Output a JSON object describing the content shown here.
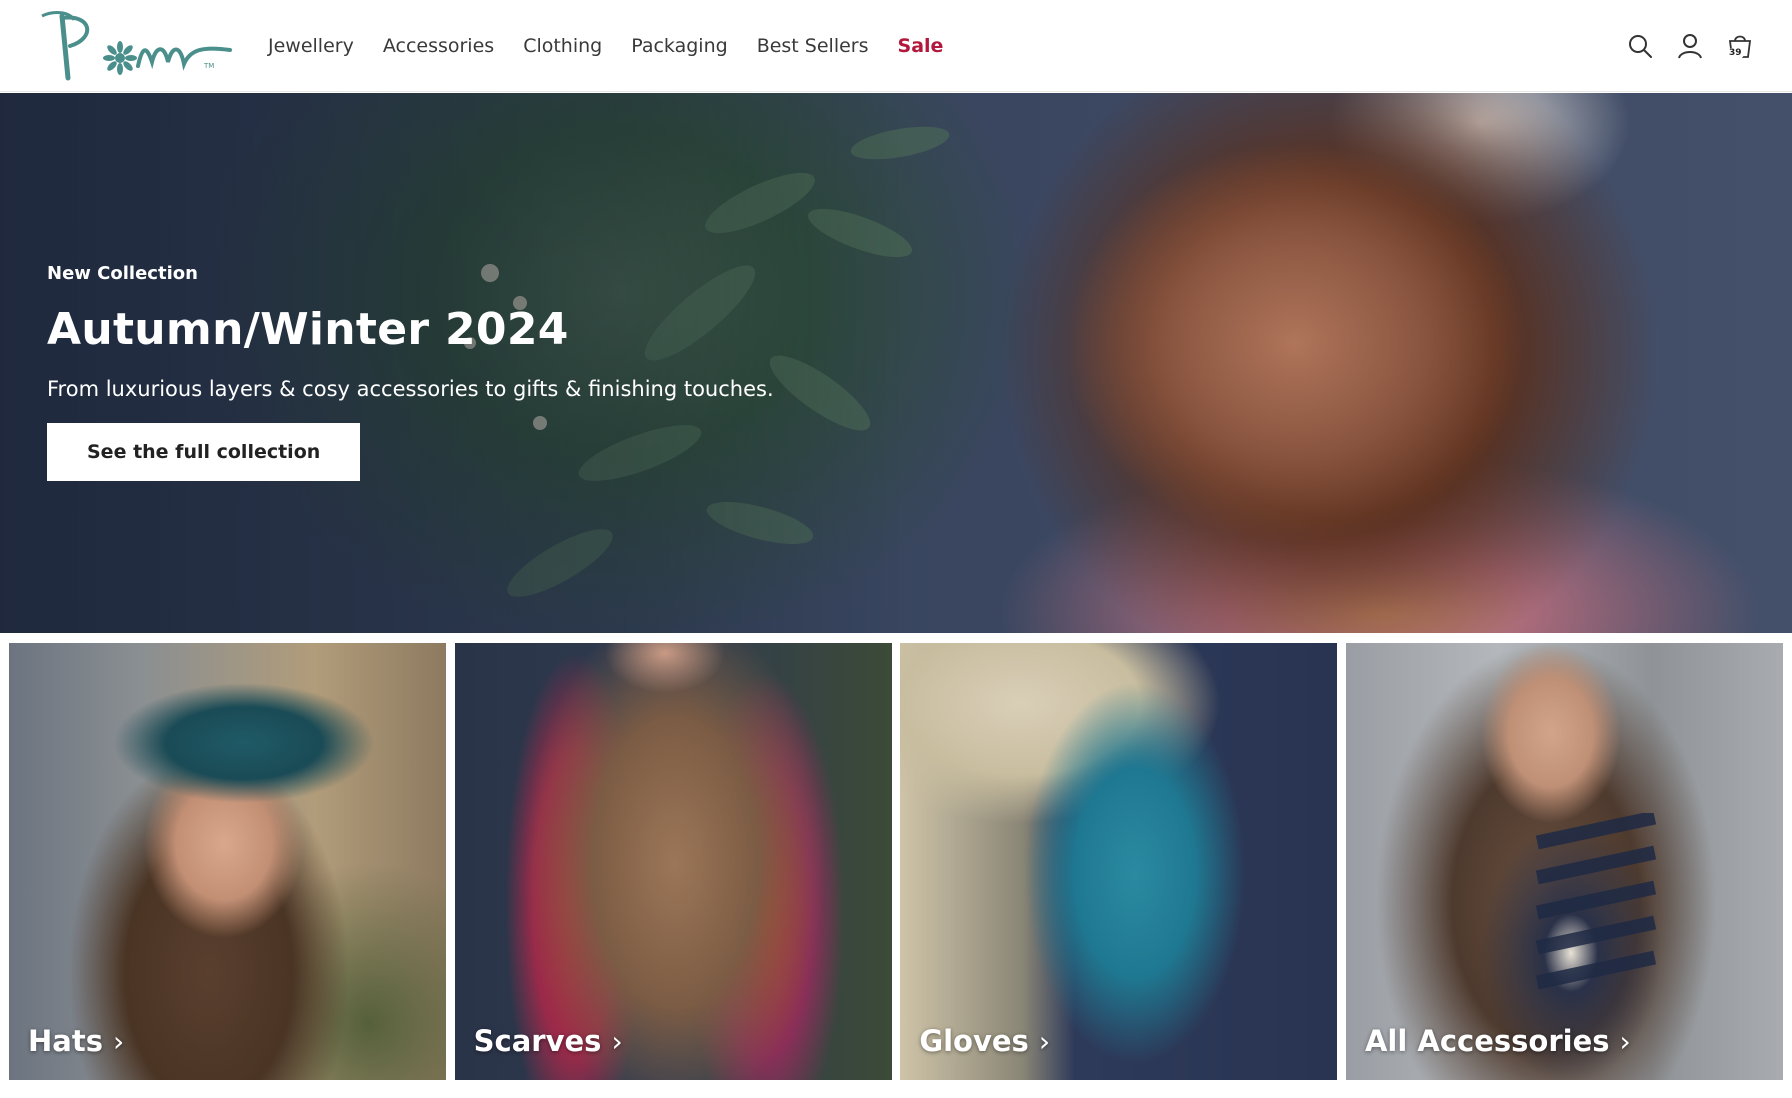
{
  "brand": {
    "logo_text": "Pom",
    "trademark": "TM"
  },
  "nav": {
    "items": [
      "Jewellery",
      "Accessories",
      "Clothing",
      "Packaging",
      "Best Sellers"
    ],
    "sale_label": "Sale"
  },
  "header_icons": {
    "search": "search-icon",
    "account": "user-icon",
    "cart": "bag-icon",
    "cart_count": "39"
  },
  "hero": {
    "eyebrow": "New Collection",
    "title": "Autumn/Winter 2024",
    "subtitle": "From luxurious layers & cosy accessories to gifts & finishing touches.",
    "cta": "See the full collection"
  },
  "tiles": [
    {
      "label": "Hats"
    },
    {
      "label": "Scarves"
    },
    {
      "label": "Gloves"
    },
    {
      "label": "All Accessories"
    }
  ],
  "colors": {
    "logo": "#4a8f8c",
    "sale": "#b3183c",
    "nav_text": "#3a3a3a",
    "button_bg": "#ffffff"
  }
}
